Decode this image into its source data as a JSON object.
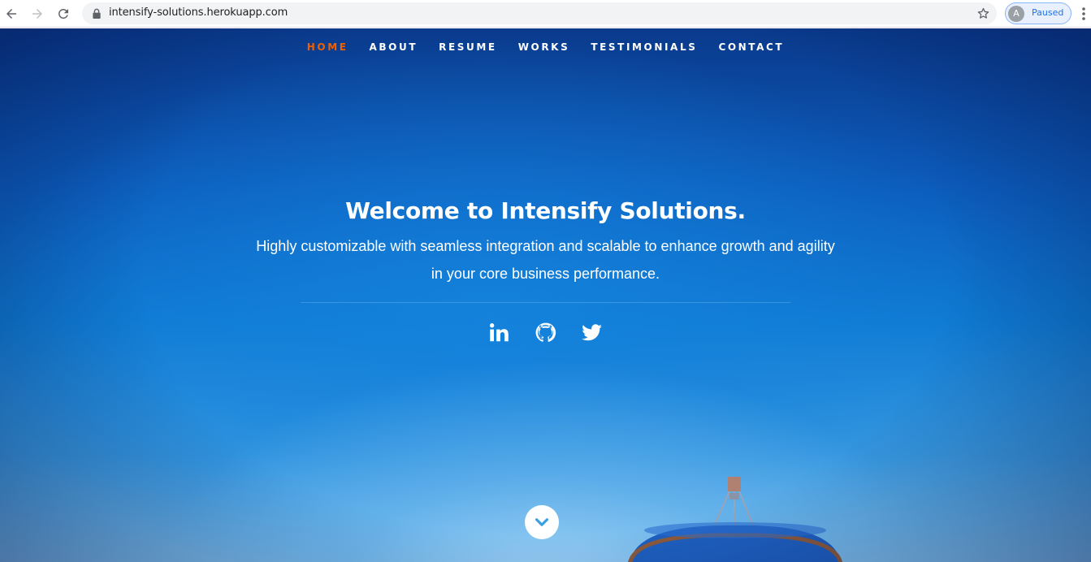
{
  "browser": {
    "url": "intensify-solutions.herokuapp.com",
    "profile_initial": "A",
    "profile_status": "Paused"
  },
  "nav": {
    "items": [
      {
        "label": "HOME",
        "active": true
      },
      {
        "label": "ABOUT",
        "active": false
      },
      {
        "label": "RESUME",
        "active": false
      },
      {
        "label": "WORKS",
        "active": false
      },
      {
        "label": "TESTIMONIALS",
        "active": false
      },
      {
        "label": "CONTACT",
        "active": false
      }
    ],
    "active_color": "#F06000"
  },
  "hero": {
    "headline": "Welcome to Intensify Solutions.",
    "subtitle_line1": "Highly customizable with seamless integration and scalable to enhance growth and agility",
    "subtitle_line2": "in your core business performance.",
    "socials": [
      "linkedin-icon",
      "github-icon",
      "twitter-icon"
    ],
    "scroll_icon": "chevron-down-icon"
  }
}
